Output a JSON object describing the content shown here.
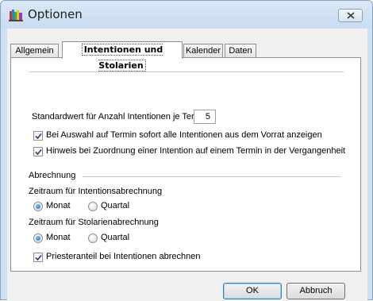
{
  "window": {
    "title": "Optionen"
  },
  "tabs": [
    {
      "label": "Allgemein",
      "active": false
    },
    {
      "label": "Intentionen und Stolarien",
      "active": true
    },
    {
      "label": "Kalender",
      "active": false
    },
    {
      "label": "Daten",
      "active": false
    }
  ],
  "settings": {
    "default_count_label": "Standardwert für Anzahl Intentionen je Termin",
    "default_count_value": "5",
    "show_all_label": "Bei Auswahl auf Termin sofort alle Intentionen aus dem Vorrat anzeigen",
    "show_all_checked": true,
    "past_hint_label": "Hinweis bei Zuordnung einer Intention auf einem Termin in der Vergangenheit",
    "past_hint_checked": true
  },
  "billing": {
    "section_label": "Abrechnung",
    "intentions_period_label": "Zeitraum für Intentionsabrechnung",
    "intentions_period_options": [
      "Monat",
      "Quartal"
    ],
    "intentions_period_selected": "Monat",
    "stolarien_period_label": "Zeitraum für Stolarienabrechnung",
    "stolarien_period_options": [
      "Monat",
      "Quartal"
    ],
    "stolarien_period_selected": "Monat",
    "priest_share_label": "Priesteranteil bei Intentionen abrechnen",
    "priest_share_checked": true
  },
  "buttons": {
    "ok": "OK",
    "cancel": "Abbruch"
  }
}
